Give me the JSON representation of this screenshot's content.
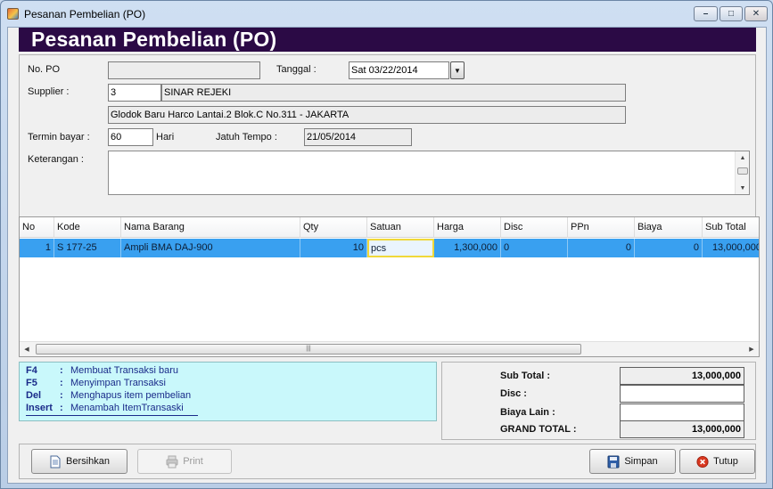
{
  "window": {
    "title": "Pesanan Pembelian (PO)",
    "min": "–",
    "max": "□",
    "close": "✕"
  },
  "banner": {
    "title": "Pesanan Pembelian (PO)"
  },
  "form": {
    "no_po_label": "No. PO",
    "no_po_value": "",
    "tanggal_label": "Tanggal :",
    "tanggal_value": "Sat 03/22/2014",
    "supplier_label": "Supplier :",
    "supplier_code": "3",
    "supplier_name": "SINAR REJEKI",
    "supplier_address": "Glodok Baru Harco  Lantai.2 Blok.C No.311 - JAKARTA",
    "termin_label": "Termin bayar :",
    "termin_value": "60",
    "hari_label": "Hari",
    "jatuh_tempo_label": "Jatuh Tempo :",
    "jatuh_tempo_value": "21/05/2014",
    "keterangan_label": "Keterangan :",
    "keterangan_value": ""
  },
  "table": {
    "columns": [
      "No",
      "Kode",
      "Nama Barang",
      "Qty",
      "Satuan",
      "Harga",
      "Disc",
      "PPn",
      "Biaya",
      "Sub Total"
    ],
    "rows": [
      {
        "no": "1",
        "kode": "S 177-25",
        "nama": "Ampli BMA DAJ-900",
        "qty": "10",
        "satuan": "pcs",
        "harga": "1,300,000",
        "disc": "0",
        "ppn": "0",
        "biaya": "0",
        "subtotal": "13,000,000"
      }
    ],
    "scroll_grip": "|||"
  },
  "help": [
    {
      "key": "F4",
      "colon": ":",
      "text": "Membuat Transaksi baru"
    },
    {
      "key": "F5",
      "colon": ":",
      "text": "Menyimpan Transaksi"
    },
    {
      "key": "Del",
      "colon": ":",
      "text": "Menghapus item pembelian"
    },
    {
      "key": "Insert",
      "colon": ":",
      "text": "Menambah ItemTransaski"
    }
  ],
  "totals": {
    "sub_total_label": "Sub Total :",
    "sub_total_value": "13,000,000",
    "disc_label": "Disc :",
    "disc_value": "",
    "biaya_lain_label": "Biaya Lain :",
    "biaya_lain_value": "",
    "grand_total_label": "GRAND TOTAL :",
    "grand_total_value": "13,000,000"
  },
  "buttons": {
    "bersihkan": "Bersihkan",
    "print": "Print",
    "simpan": "Simpan",
    "tutup": "Tutup"
  },
  "icons": {
    "app": "app-icon",
    "bersihkan": "document-icon",
    "print": "printer-icon",
    "simpan": "floppy-disk-icon",
    "tutup": "close-circle-icon"
  },
  "colors": {
    "banner": "#2b0a45",
    "selected_row": "#39a0f0",
    "help_bg": "#c9f8fb",
    "cell_edit_border": "#f0d83a"
  }
}
